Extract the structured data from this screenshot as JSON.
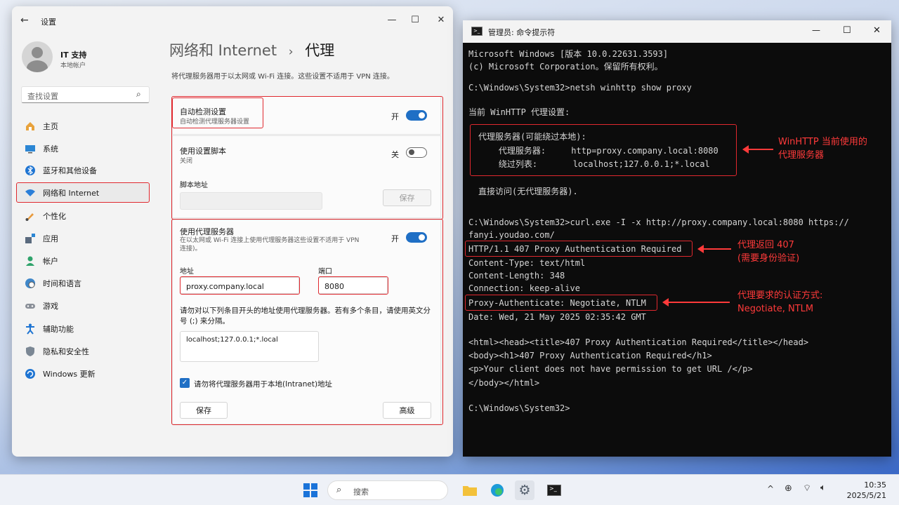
{
  "settings": {
    "title": "设置",
    "user": {
      "name": "IT 支持",
      "type": "本地帐户"
    },
    "search_placeholder": "查找设置",
    "nav": [
      {
        "label": "主页",
        "icon": "home-icon"
      },
      {
        "label": "系统",
        "icon": "monitor-icon"
      },
      {
        "label": "蓝牙和其他设备",
        "icon": "bluetooth-icon"
      },
      {
        "label": "网络和 Internet",
        "icon": "wifi-icon"
      },
      {
        "label": "个性化",
        "icon": "brush-icon"
      },
      {
        "label": "应用",
        "icon": "apps-icon"
      },
      {
        "label": "帐户",
        "icon": "person-icon"
      },
      {
        "label": "时间和语言",
        "icon": "globe-clock-icon"
      },
      {
        "label": "游戏",
        "icon": "gamepad-icon"
      },
      {
        "label": "辅助功能",
        "icon": "accessibility-icon"
      },
      {
        "label": "隐私和安全性",
        "icon": "shield-icon"
      },
      {
        "label": "Windows 更新",
        "icon": "refresh-icon"
      }
    ],
    "breadcrumb": {
      "parent": "网络和 Internet",
      "separator": "›",
      "current": "代理"
    },
    "description": "将代理服务器用于以太网或 Wi-Fi 连接。这些设置不适用于 VPN 连接。",
    "auto_detect": {
      "title": "自动检测设置",
      "subtitle": "自动检测代理服务器设置",
      "state": "开"
    },
    "setup_script": {
      "title": "使用设置脚本",
      "subtitle": "关闭",
      "state": "关",
      "script_label": "脚本地址",
      "save": "保存"
    },
    "manual": {
      "title": "使用代理服务器",
      "subtitle": "在以太网或 Wi-Fi 连接上使用代理服务器这些设置不适用于 VPN 连接)。",
      "state": "开",
      "address_label": "地址",
      "address_value": "proxy.company.local",
      "port_label": "端口",
      "port_value": "8080",
      "exceptions_label": "请勿对以下列条目开头的地址使用代理服务器。若有多个条目，请使用英文分号 (;) 来分隔。",
      "exceptions_value": "localhost;127.0.0.1;*.local",
      "local_checkbox": "请勿将代理服务器用于本地(Intranet)地址",
      "save": "保存",
      "advanced": "高级"
    }
  },
  "cmd": {
    "title": "管理员: 命令提示符",
    "lines": [
      "Microsoft Windows [版本 10.0.22631.3593]",
      "(c) Microsoft Corporation。保留所有权利。",
      "C:\\Windows\\System32>netsh winhttp show proxy",
      "当前 WinHTTP 代理设置:",
      "代理服务器(可能绕过本地):",
      "    代理服务器:     http=proxy.company.local:8080",
      "    绕过列表:       localhost;127.0.0.1;*.local",
      "直接访问(无代理服务器).",
      "C:\\Windows\\System32>curl.exe -I -x http://proxy.company.local:8080 https://",
      "fanyi.youdao.com/",
      "HTTP/1.1 407 Proxy Authentication Required",
      "Content-Type: text/html",
      "Content-Length: 348",
      "Connection: keep-alive",
      "Proxy-Authenticate: Negotiate, NTLM",
      "Date: Wed, 21 May 2025 02:35:42 GMT",
      "<html><head><title>407 Proxy Authentication Required</title></head>",
      "<body><h1>407 Proxy Authentication Required</h1>",
      "<p>Your client does not have permission to get URL /</p>",
      "</body></html>",
      "C:\\Windows\\System32>"
    ],
    "annotations": [
      "WinHTTP 当前使用的\n代理服务器",
      "代理返回 407\n(需要身份验证)",
      "代理要求的认证方式:\nNegotiate, NTLM"
    ]
  },
  "taskbar": {
    "search": "搜索",
    "time": "10:35",
    "date": "2025/5/21"
  },
  "colors": {
    "accent": "#1f6fc5",
    "annotation": "#e0282e"
  }
}
